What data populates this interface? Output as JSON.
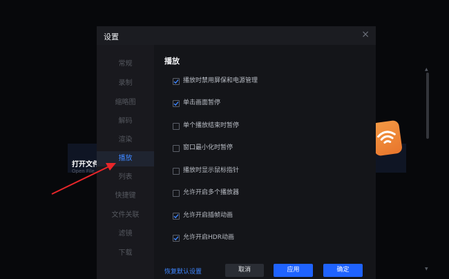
{
  "background": {
    "title": "打开文件",
    "subtitle": "Open File"
  },
  "dialog": {
    "title": "设置",
    "close": "×",
    "nav": [
      {
        "label": "常规",
        "active": false
      },
      {
        "label": "录制",
        "active": false
      },
      {
        "label": "缩略图",
        "active": false
      },
      {
        "label": "解码",
        "active": false
      },
      {
        "label": "渲染",
        "active": false
      },
      {
        "label": "播放",
        "active": true
      },
      {
        "label": "列表",
        "active": false
      },
      {
        "label": "快捷键",
        "active": false
      },
      {
        "label": "文件关联",
        "active": false
      },
      {
        "label": "滤镜",
        "active": false
      },
      {
        "label": "下载",
        "active": false
      }
    ],
    "section_title": "播放",
    "options": [
      {
        "label": "播放时禁用屏保和电源管理",
        "checked": true
      },
      {
        "label": "单击画面暂停",
        "checked": true
      },
      {
        "label": "单个播放结束时暂停",
        "checked": false
      },
      {
        "label": "窗口最小化时暂停",
        "checked": false
      },
      {
        "label": "播放时显示鼠标指针",
        "checked": false
      },
      {
        "label": "允许开启多个播放器",
        "checked": false
      },
      {
        "label": "允许开启插帧动画",
        "checked": true
      },
      {
        "label": "允许开启HDR动画",
        "checked": true
      }
    ],
    "restore_label": "恢复默认设置",
    "cancel_label": "取消",
    "apply_label": "应用",
    "ok_label": "确定"
  },
  "colors": {
    "accent": "#1f63ff",
    "active_nav": "#3e86ff",
    "annotation_arrow": "#e8262a"
  }
}
